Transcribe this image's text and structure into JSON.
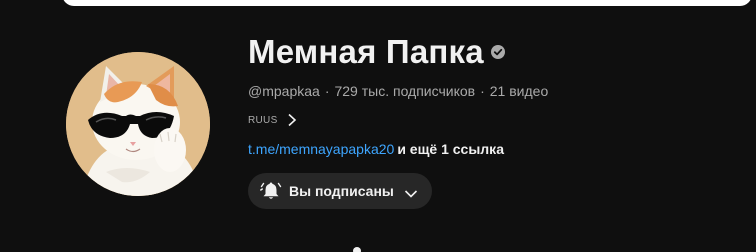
{
  "channel": {
    "title": "Мемная Папка",
    "handle": "@mpapkaa",
    "subscribers": "729 тыс. подписчиков",
    "videos": "21 видео",
    "separator": "·",
    "verified": true
  },
  "description": {
    "text": "RUUS"
  },
  "links": {
    "main": "t.me/memnayapapka20",
    "more": "и ещё 1 ссылка"
  },
  "subscribe": {
    "label": "Вы подписаны"
  },
  "colors": {
    "background": "#0f0f0f",
    "link": "#3ea6ff",
    "button_bg": "#272727",
    "muted_text": "#aaaaaa"
  },
  "icons": [
    "verified-icon",
    "chevron-right-icon",
    "bell-icon",
    "chevron-down-icon"
  ]
}
